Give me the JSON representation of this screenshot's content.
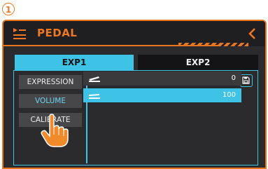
{
  "step_badge": "1",
  "header": {
    "title": "PEDAL",
    "back_icon": "chevron-left-icon",
    "pedal_icon": "pedal-icon"
  },
  "tabs": [
    {
      "label": "EXP1",
      "selected": true
    },
    {
      "label": "EXP2",
      "selected": false
    }
  ],
  "menu": [
    {
      "label": "EXPRESSION",
      "selected": false
    },
    {
      "label": "VOLUME",
      "selected": true
    },
    {
      "label": "CALIBRATE",
      "selected": false
    }
  ],
  "save_icon": "save-icon",
  "rows": [
    {
      "icon": "pedal-up-icon",
      "value": "0",
      "selected": false
    },
    {
      "icon": "pedal-down-icon",
      "value": "100",
      "selected": true
    }
  ],
  "colors": {
    "accent": "#f07820",
    "highlight": "#3ec3e6",
    "background": "#2b2b2d"
  }
}
